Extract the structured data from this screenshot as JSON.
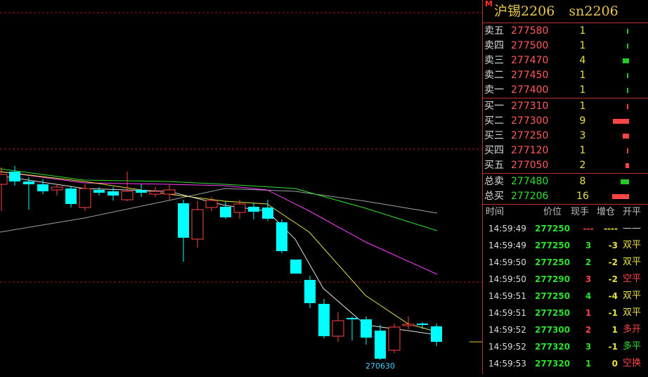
{
  "chart": {
    "low_label": "270630",
    "colors": {
      "up": "#ff4444",
      "down": "#00ffff",
      "ma5": "#e0e0e0",
      "ma10": "#e8e040",
      "ma20": "#ff40ff",
      "ma40": "#30e030",
      "ma60": "#a0a0a0",
      "grid": "#a02020"
    }
  },
  "quote": {
    "title_marker": "M",
    "name": "沪锡2206",
    "code": "sn2206",
    "asks": [
      {
        "label": "卖五",
        "price": "277580",
        "volume": "1"
      },
      {
        "label": "卖四",
        "price": "277500",
        "volume": "1"
      },
      {
        "label": "卖三",
        "price": "277470",
        "volume": "4"
      },
      {
        "label": "卖二",
        "price": "277450",
        "volume": "1"
      },
      {
        "label": "卖一",
        "price": "277400",
        "volume": "1"
      }
    ],
    "bids": [
      {
        "label": "买一",
        "price": "277310",
        "volume": "1"
      },
      {
        "label": "买二",
        "price": "277300",
        "volume": "9"
      },
      {
        "label": "买三",
        "price": "277250",
        "volume": "3"
      },
      {
        "label": "买四",
        "price": "277120",
        "volume": "1"
      },
      {
        "label": "买五",
        "price": "277050",
        "volume": "2"
      }
    ],
    "totals": [
      {
        "label": "总卖",
        "price": "277480",
        "volume": "8"
      },
      {
        "label": "总买",
        "price": "277206",
        "volume": "16"
      }
    ]
  },
  "ticks": {
    "headers": {
      "time": "时间",
      "price": "价位",
      "volume": "现手",
      "oi_change": "增仓",
      "type": "开平"
    },
    "rows": [
      {
        "time": "14:59:49",
        "price": "277250",
        "volume": "---",
        "oi_change": "----",
        "type": "——",
        "vcolor": "#ff4444",
        "ccolor": "#e8e040",
        "tcolor": "#dcdcdc"
      },
      {
        "time": "14:59:49",
        "price": "277250",
        "volume": "3",
        "oi_change": "-3",
        "type": "双平",
        "vcolor": "#2ce02c",
        "ccolor": "#e8e040",
        "tcolor": "#e8e040"
      },
      {
        "time": "14:59:50",
        "price": "277250",
        "volume": "2",
        "oi_change": "-2",
        "type": "双平",
        "vcolor": "#2ce02c",
        "ccolor": "#e8e040",
        "tcolor": "#e8e040"
      },
      {
        "time": "14:59:50",
        "price": "277290",
        "volume": "3",
        "oi_change": "-2",
        "type": "空平",
        "vcolor": "#ff4444",
        "ccolor": "#e8e040",
        "tcolor": "#ff4444"
      },
      {
        "time": "14:59:51",
        "price": "277250",
        "volume": "4",
        "oi_change": "-4",
        "type": "双平",
        "vcolor": "#2ce02c",
        "ccolor": "#e8e040",
        "tcolor": "#e8e040"
      },
      {
        "time": "14:59:51",
        "price": "277250",
        "volume": "1",
        "oi_change": "-1",
        "type": "双平",
        "vcolor": "#ff4444",
        "ccolor": "#e8e040",
        "tcolor": "#e8e040"
      },
      {
        "time": "14:59:52",
        "price": "277300",
        "volume": "2",
        "oi_change": "1",
        "type": "多开",
        "vcolor": "#ff4444",
        "ccolor": "#e8e040",
        "tcolor": "#ff4444"
      },
      {
        "time": "14:59:52",
        "price": "277320",
        "volume": "3",
        "oi_change": "-1",
        "type": "多平",
        "vcolor": "#2ce02c",
        "ccolor": "#e8e040",
        "tcolor": "#2ce02c"
      },
      {
        "time": "14:59:53",
        "price": "277320",
        "volume": "1",
        "oi_change": "0",
        "type": "空换",
        "vcolor": "#2ce02c",
        "ccolor": "#e8e040",
        "tcolor": "#ff4444"
      }
    ]
  }
}
